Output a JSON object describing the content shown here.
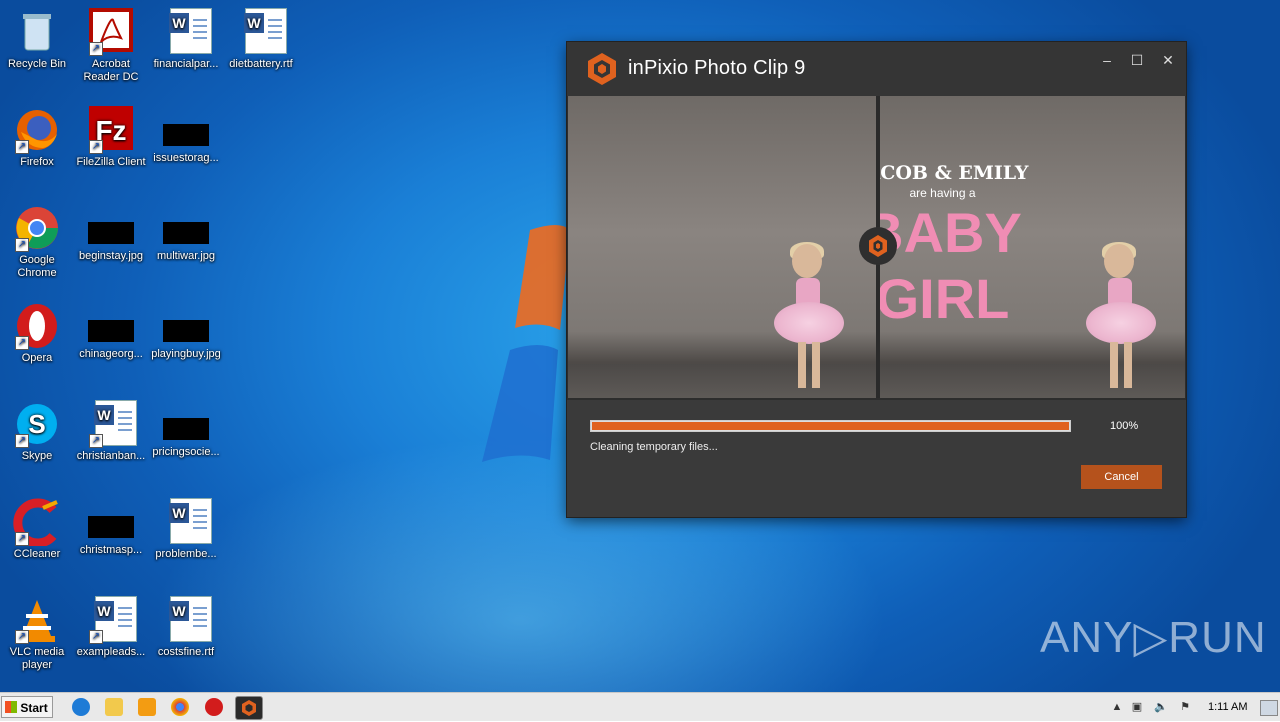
{
  "desktop": {
    "icons": [
      {
        "label": "Recycle Bin"
      },
      {
        "label": "Acrobat Reader DC"
      },
      {
        "label": "financialpar..."
      },
      {
        "label": "dietbattery.rtf"
      },
      {
        "label": "Firefox"
      },
      {
        "label": "FileZilla Client"
      },
      {
        "label": "issuestorag..."
      },
      {
        "label": "Google Chrome"
      },
      {
        "label": "beginstay.jpg"
      },
      {
        "label": "multiwar.jpg"
      },
      {
        "label": "Opera"
      },
      {
        "label": "chinageorg..."
      },
      {
        "label": "playingbuy.jpg"
      },
      {
        "label": "Skype"
      },
      {
        "label": "christianban..."
      },
      {
        "label": "pricingsocie..."
      },
      {
        "label": "CCleaner"
      },
      {
        "label": "christmasp..."
      },
      {
        "label": "problembe..."
      },
      {
        "label": "VLC media player"
      },
      {
        "label": "exampleads..."
      },
      {
        "label": "costsfine.rtf"
      }
    ]
  },
  "window": {
    "title": "inPixio Photo Clip 9",
    "minimize": "–",
    "maximize": "☐",
    "close": "✕",
    "image_text": {
      "line1": "JACOB & EMILY",
      "line2": "are having a",
      "line3": "BABY",
      "line4": "GIRL"
    },
    "progress": {
      "percent_text": "100%",
      "fraction": 1.0,
      "status": "Cleaning temporary files...",
      "cancel_label": "Cancel"
    }
  },
  "taskbar": {
    "start_label": "Start",
    "clock": "1:11 AM"
  },
  "watermark": "ANY▷RUN",
  "colors": {
    "accent": "#e0621f",
    "cancel": "#b5521c",
    "pink_text": "#f08db4"
  }
}
